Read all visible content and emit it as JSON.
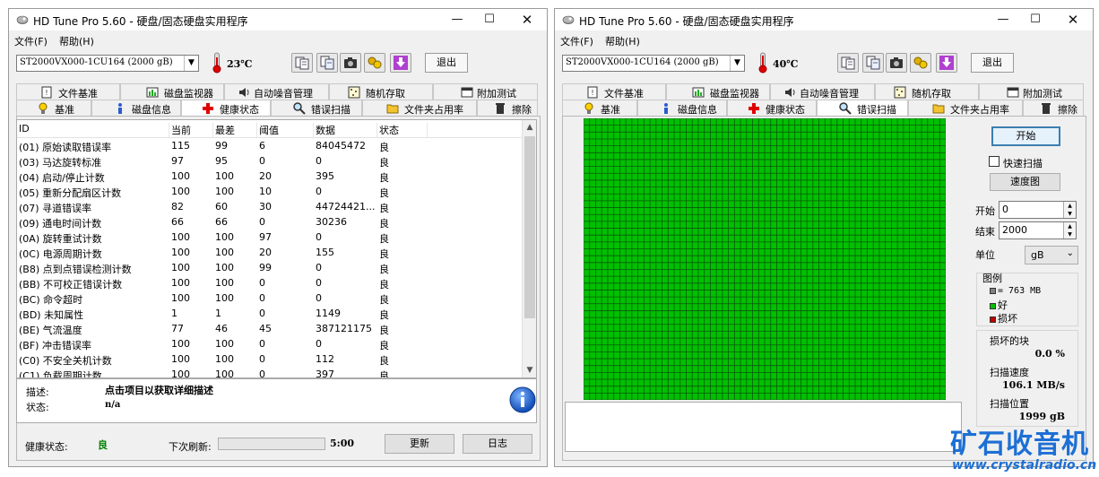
{
  "app": {
    "title": "HD Tune Pro 5.60 - 硬盘/固态硬盘实用程序",
    "menu": [
      "文件(F)",
      "帮助(H)"
    ],
    "window_controls": {
      "minimize": "—",
      "maximize": "☐",
      "close": "✕"
    }
  },
  "left": {
    "drive": "ST2000VX000-1CU164 (2000 gB)",
    "temperature": "23℃",
    "exit_label": "退出",
    "tabs_row1": [
      "文件基准",
      "磁盘监视器",
      "自动噪音管理",
      "随机存取",
      "附加测试"
    ],
    "tabs_row2": [
      "基准",
      "磁盘信息",
      "健康状态",
      "错误扫描",
      "文件夹占用率",
      "擦除"
    ],
    "active_tab": "健康状态",
    "smart": {
      "columns": [
        "ID",
        "当前",
        "最差",
        "阈值",
        "数据",
        "状态"
      ],
      "rows": [
        [
          "(01) 原始读取错误率",
          "115",
          "99",
          "6",
          "84045472",
          "良"
        ],
        [
          "(03) 马达旋转标准",
          "97",
          "95",
          "0",
          "0",
          "良"
        ],
        [
          "(04) 启动/停止计数",
          "100",
          "100",
          "20",
          "395",
          "良"
        ],
        [
          "(05) 重新分配扇区计数",
          "100",
          "100",
          "10",
          "0",
          "良"
        ],
        [
          "(07) 寻道错误率",
          "82",
          "60",
          "30",
          "44724421...",
          "良"
        ],
        [
          "(09) 通电时间计数",
          "66",
          "66",
          "0",
          "30236",
          "良"
        ],
        [
          "(0A) 旋转重试计数",
          "100",
          "100",
          "97",
          "0",
          "良"
        ],
        [
          "(0C) 电源周期计数",
          "100",
          "100",
          "20",
          "155",
          "良"
        ],
        [
          "(B8) 点到点错误检测计数",
          "100",
          "100",
          "99",
          "0",
          "良"
        ],
        [
          "(BB) 不可校正错误计数",
          "100",
          "100",
          "0",
          "0",
          "良"
        ],
        [
          "(BC) 命令超时",
          "100",
          "100",
          "0",
          "0",
          "良"
        ],
        [
          "(BD) 未知属性",
          "1",
          "1",
          "0",
          "1149",
          "良"
        ],
        [
          "(BE) 气流温度",
          "77",
          "46",
          "45",
          "387121175",
          "良"
        ],
        [
          "(BF) 冲击错误率",
          "100",
          "100",
          "0",
          "0",
          "良"
        ],
        [
          "(C0) 不安全关机计数",
          "100",
          "100",
          "0",
          "112",
          "良"
        ],
        [
          "(C1) 负载周期计数",
          "100",
          "100",
          "0",
          "397",
          "良"
        ]
      ]
    },
    "desc_label": "描述:",
    "desc_value": "点击项目以获取详细描述",
    "status_label": "状态:",
    "status_value": "n/a",
    "health_label": "健康状态:",
    "health_value": "良",
    "next_refresh_label": "下次刷新:",
    "next_refresh_time": "5:00",
    "update_button": "更新",
    "log_button": "日志",
    "refresh_progress": 0
  },
  "right": {
    "drive": "ST2000VX000-1CU164 (2000 gB)",
    "temperature": "40℃",
    "exit_label": "退出",
    "tabs_row1": [
      "文件基准",
      "磁盘监视器",
      "自动噪音管理",
      "随机存取",
      "附加测试"
    ],
    "tabs_row2": [
      "基准",
      "磁盘信息",
      "健康状态",
      "错误扫描",
      "文件夹占用率",
      "擦除"
    ],
    "active_tab": "错误扫描",
    "start_button": "开始",
    "quick_scan_label": "快速扫描",
    "quick_scan_checked": false,
    "speed_map_button": "速度图",
    "start_label": "开始",
    "start_value": "0",
    "end_label": "结束",
    "end_value": "2000",
    "unit_label": "单位",
    "unit_value": "gB",
    "legend_title": "图例",
    "legend_block": "= 763 MB",
    "legend_good": "好",
    "legend_bad": "损坏",
    "damaged_blocks_label": "损坏的块",
    "damaged_blocks_value": "0.0 %",
    "scan_speed_label": "扫描速度",
    "scan_speed_value": "106.1 MB/s",
    "scan_position_label": "扫描位置",
    "scan_position_value": "1999 gB",
    "grid": {
      "cols": 60,
      "rows": 41
    },
    "colors": {
      "good": "#00c000",
      "bad": "#c00000",
      "block": "#808080"
    }
  },
  "watermark": {
    "text": "矿石收音机",
    "url": "www.crystalradio.cn"
  }
}
